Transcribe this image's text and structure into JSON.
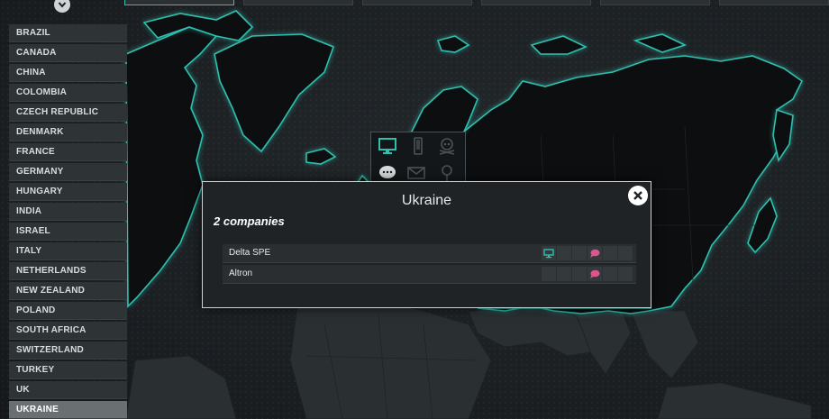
{
  "countries": [
    {
      "label": "BRAZIL",
      "selected": false
    },
    {
      "label": "CANADA",
      "selected": false
    },
    {
      "label": "CHINA",
      "selected": false
    },
    {
      "label": "COLOMBIA",
      "selected": false
    },
    {
      "label": "CZECH REPUBLIC",
      "selected": false
    },
    {
      "label": "DENMARK",
      "selected": false
    },
    {
      "label": "FRANCE",
      "selected": false
    },
    {
      "label": "GERMANY",
      "selected": false
    },
    {
      "label": "HUNGARY",
      "selected": false
    },
    {
      "label": "INDIA",
      "selected": false
    },
    {
      "label": "ISRAEL",
      "selected": false
    },
    {
      "label": "ITALY",
      "selected": false
    },
    {
      "label": "NETHERLANDS",
      "selected": false
    },
    {
      "label": "NEW ZEALAND",
      "selected": false
    },
    {
      "label": "POLAND",
      "selected": false
    },
    {
      "label": "SOUTH AFRICA",
      "selected": false
    },
    {
      "label": "SWITZERLAND",
      "selected": false
    },
    {
      "label": "TURKEY",
      "selected": false
    },
    {
      "label": "UK",
      "selected": false
    },
    {
      "label": "UKRAINE",
      "selected": true
    }
  ],
  "category_icons": [
    "monitor-icon",
    "phone-icon",
    "skull-icon",
    "chat-icon",
    "mail-icon",
    "pin-icon"
  ],
  "popup": {
    "title": "Ukraine",
    "count_text": "2 companies",
    "close_icon": "close-icon",
    "companies": [
      {
        "name": "Delta SPE",
        "flags": [
          "monitor",
          "none",
          "none",
          "chat",
          "none",
          "none"
        ]
      },
      {
        "name": "Altron",
        "flags": [
          "none",
          "none",
          "none",
          "chat",
          "none",
          "none"
        ]
      }
    ]
  },
  "colors": {
    "accent": "#2fbfae",
    "chat": "#d8578f",
    "selected_row": "#6a6f72",
    "panel": "#1f2326"
  }
}
